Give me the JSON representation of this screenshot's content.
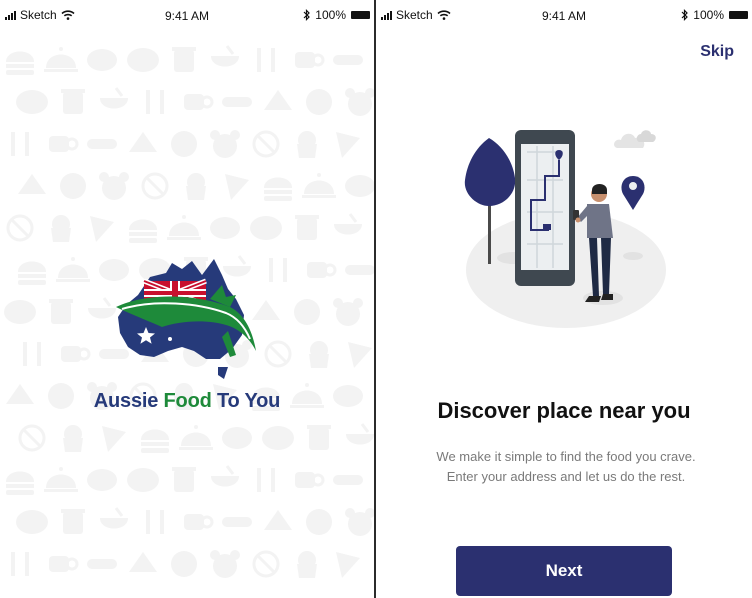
{
  "status_bar": {
    "carrier": "Sketch",
    "time": "9:41 AM",
    "battery": "100%"
  },
  "splash": {
    "brand_word1": "Aussie",
    "brand_word2": "Food",
    "brand_word3": "To You",
    "pattern_icons": [
      "burger-icon",
      "cloche-icon",
      "steak-icon",
      "pizza-icon",
      "drink-icon",
      "bowl-icon",
      "cutlery-icon",
      "coffee-icon",
      "hotdog-icon",
      "cake-icon",
      "donut-icon",
      "panda-icon",
      "no-food-icon",
      "cupcake-icon",
      "pizza-slice-icon"
    ]
  },
  "onboarding": {
    "skip_label": "Skip",
    "title": "Discover place near you",
    "description": "We make it simple to find the food you crave. Enter your address and let us do the rest.",
    "next_label": "Next"
  },
  "colors": {
    "primary": "#2b3070",
    "brand_blue": "#263a7a",
    "brand_green": "#1e8a3a",
    "pattern_gray": "#f3f3f3"
  }
}
